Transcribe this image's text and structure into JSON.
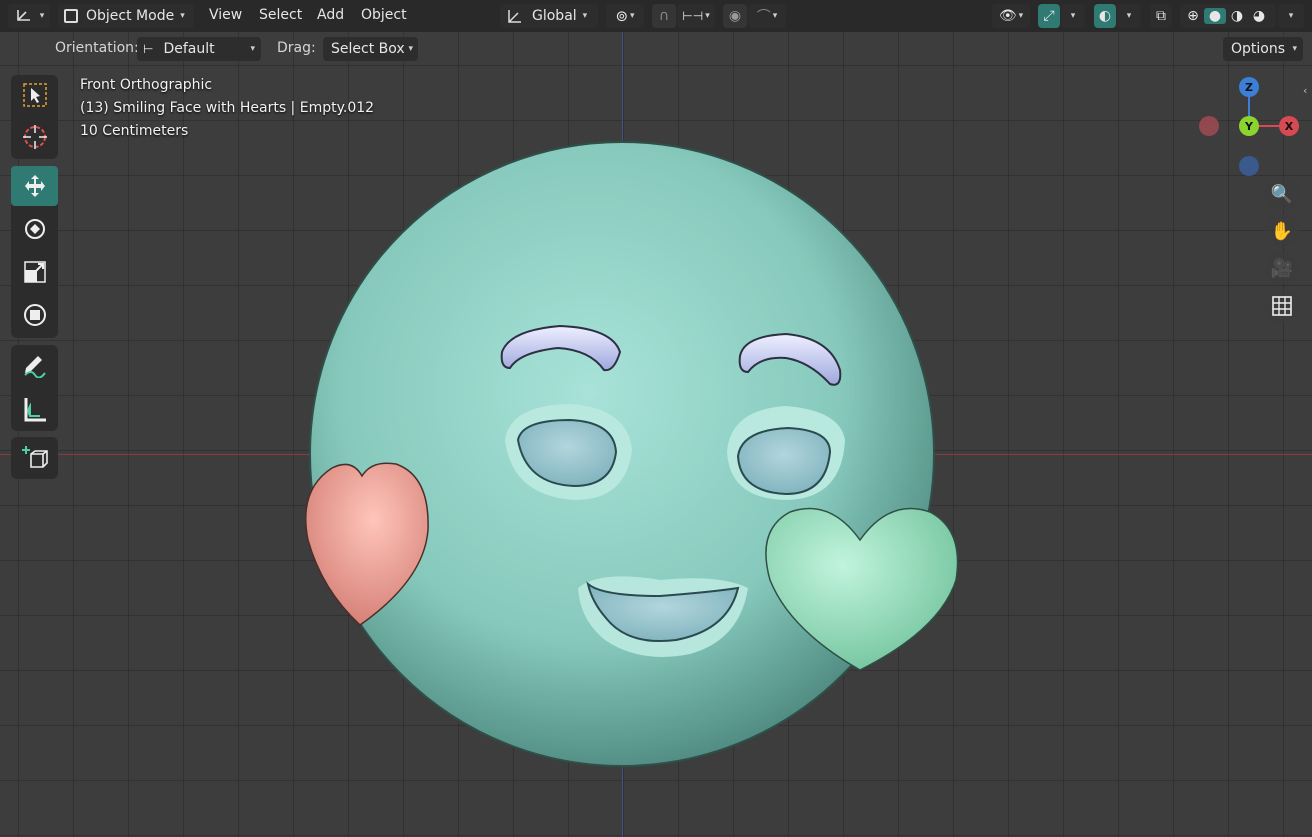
{
  "header": {
    "mode": "Object Mode",
    "menus": [
      "View",
      "Select",
      "Add",
      "Object"
    ],
    "transform_orientation": "Global",
    "options": "Options"
  },
  "subheader": {
    "orientation_label": "Orientation:",
    "orientation_value": "Default",
    "drag_label": "Drag:",
    "drag_value": "Select Box"
  },
  "overlay": {
    "view_name": "Front Orthographic",
    "object_info": "(13) Smiling Face with Hearts | Empty.012",
    "scale": "10 Centimeters"
  },
  "gizmo": {
    "z": "Z",
    "y": "Y",
    "x": "X"
  },
  "colors": {
    "accent": "#2f7a72",
    "face": "#8fd1c5",
    "heart_left": "#f0a59a",
    "heart_right": "#98e0bf",
    "brows": "#c9cfee",
    "eyes": "#9fc9d1",
    "axis_red": "#d84a52",
    "axis_green": "#8bd430",
    "axis_blue": "#3b7fd8"
  }
}
